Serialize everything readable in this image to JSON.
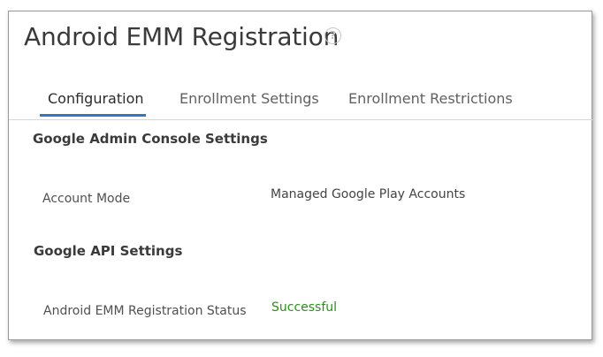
{
  "header": {
    "title": "Android EMM Registration",
    "help_icon": "help-circle-icon",
    "help_glyph": "?"
  },
  "tabs": [
    {
      "label": "Configuration",
      "active": true
    },
    {
      "label": "Enrollment Settings",
      "active": false
    },
    {
      "label": "Enrollment Restrictions",
      "active": false
    }
  ],
  "sections": {
    "admin_console": {
      "title": "Google Admin Console Settings",
      "account_mode_label": "Account Mode",
      "account_mode_value": "Managed Google Play Accounts"
    },
    "api": {
      "title": "Google API Settings",
      "status_label": "Android EMM Registration Status",
      "status_value": "Successful"
    }
  },
  "colors": {
    "accent": "#2b7bc2",
    "success": "#2e8b1e"
  }
}
